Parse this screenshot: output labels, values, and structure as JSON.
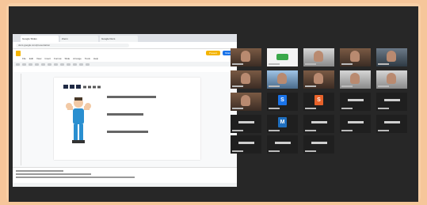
{
  "browser": {
    "tabs": [
      "Google Slides",
      "Zoom",
      "Google Docs"
    ],
    "url": "docs.google.com/presentation"
  },
  "slides_app": {
    "menu": [
      "File",
      "Edit",
      "View",
      "Insert",
      "Format",
      "Slide",
      "Arrange",
      "Tools",
      "Help"
    ],
    "present_label": "Present",
    "share_label": "Share"
  },
  "gallery": {
    "tiles": [
      {
        "kind": "video",
        "style": "cam-warm",
        "label": ""
      },
      {
        "kind": "logo",
        "style": "",
        "label": ""
      },
      {
        "kind": "video",
        "style": "cam-light",
        "label": ""
      },
      {
        "kind": "video",
        "style": "cam-warm",
        "label": ""
      },
      {
        "kind": "video",
        "style": "cam-cool",
        "label": ""
      },
      {
        "kind": "video",
        "style": "cam-warm",
        "label": ""
      },
      {
        "kind": "video",
        "style": "cam-blue",
        "label": ""
      },
      {
        "kind": "video",
        "style": "cam-warm",
        "label": ""
      },
      {
        "kind": "video",
        "style": "cam-light",
        "label": ""
      },
      {
        "kind": "video",
        "style": "cam-light",
        "label": ""
      },
      {
        "kind": "video",
        "style": "cam-warm",
        "label": ""
      },
      {
        "kind": "avatar",
        "style": "#1a73e8",
        "letter": "S",
        "label": ""
      },
      {
        "kind": "avatar",
        "style": "#e8622a",
        "letter": "S",
        "label": ""
      },
      {
        "kind": "name",
        "label": ""
      },
      {
        "kind": "name",
        "label": ""
      },
      {
        "kind": "name",
        "label": ""
      },
      {
        "kind": "avatar",
        "style": "#1f6fbf",
        "letter": "M",
        "label": ""
      },
      {
        "kind": "name",
        "label": ""
      },
      {
        "kind": "name",
        "label": ""
      },
      {
        "kind": "name",
        "label": ""
      },
      {
        "kind": "name",
        "label": ""
      },
      {
        "kind": "name",
        "label": ""
      },
      {
        "kind": "name",
        "label": ""
      }
    ]
  }
}
